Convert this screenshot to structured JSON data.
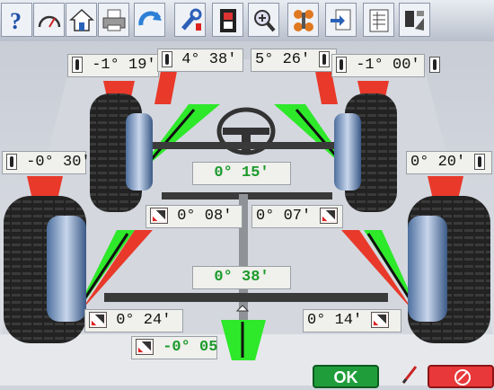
{
  "toolbar": {
    "buttons": [
      {
        "icon": "help-icon"
      },
      {
        "icon": "gauge-icon"
      },
      {
        "icon": "home-icon"
      },
      {
        "icon": "printer-icon"
      },
      {
        "icon": "rotate-icon"
      },
      {
        "icon": "wrench-icon"
      },
      {
        "icon": "film-icon"
      },
      {
        "icon": "zoom-icon"
      },
      {
        "icon": "wheels-icon"
      },
      {
        "icon": "document-arrow-icon"
      },
      {
        "icon": "worksheet-icon"
      },
      {
        "icon": "car-lift-icon"
      }
    ]
  },
  "front": {
    "left_camber": "-1° 19'",
    "left_toe": "4° 38'",
    "right_toe": "5° 26'",
    "right_camber": "-1° 00'",
    "total_toe": "0° 15'"
  },
  "middle": {
    "left_camber": "-0° 30'",
    "right_camber": "0° 20'",
    "left_setback": "0° 08'",
    "right_setback": "0° 07'"
  },
  "rear": {
    "total_toe": "0° 38'",
    "left_toe": "0° 24'",
    "right_toe": "0° 14'",
    "thrust_angle": "-0° 05"
  },
  "buttons": {
    "ok_label": "OK"
  },
  "colors": {
    "in_spec": "#1c9a2c",
    "out_of_spec": "#e8392a",
    "indicator_green": "#2ee82a"
  }
}
